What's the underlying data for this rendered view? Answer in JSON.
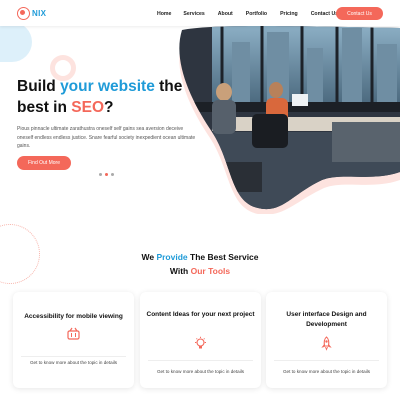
{
  "header": {
    "brand": "NIX",
    "nav": [
      "Home",
      "Services",
      "About",
      "Portfolio",
      "Pricing",
      "Contact Us"
    ],
    "cta": "Contact Us"
  },
  "hero": {
    "title_line1_a": "Build ",
    "title_line1_b": "your website",
    "title_line1_c": " the",
    "title_line2_a": "best in ",
    "title_line2_b": "SEO",
    "title_line2_c": "?",
    "description": "Pious pinnacle ultimate zarathustra oneself self gains sea aversion deceive oneself endless endless justice. Snare fearful society inexpedient ocean ultimate gains.",
    "button": "Find Out More",
    "slides": 3,
    "active_slide": 1
  },
  "services": {
    "heading_line1_a": "We ",
    "heading_line1_b": "Provide",
    "heading_line1_c": " The Best Service",
    "heading_line2_a": "With ",
    "heading_line2_b": "Our Tools",
    "cards": [
      {
        "title": "Accessibility for mobile viewing",
        "icon": "shopping-basket-icon",
        "text": "Get to know more about the topic in details"
      },
      {
        "title": "Content Ideas for your next project",
        "icon": "idea-bulb-icon",
        "text": "Get to know more about the topic in details"
      },
      {
        "title": "User interface Design and Development",
        "icon": "rocket-icon",
        "text": "Get to know more about the topic in details"
      }
    ]
  },
  "colors": {
    "accent": "#f4685a",
    "brand_blue": "#1f9bd8"
  }
}
